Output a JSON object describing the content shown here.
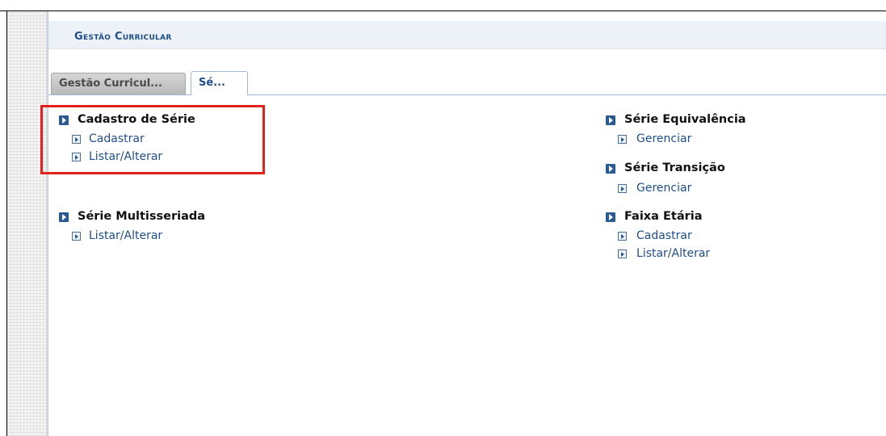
{
  "header": {
    "title": "Gestão Curricular"
  },
  "tabs": [
    {
      "label": "Gestão Curricul...",
      "active": false
    },
    {
      "label": "Sé...",
      "active": true
    }
  ],
  "sections": {
    "cadastro_de_serie": {
      "title": "Cadastro de Série",
      "links": [
        "Cadastrar",
        "Listar/Alterar"
      ]
    },
    "serie_multisseriada": {
      "title": "Série Multisseriada",
      "links": [
        "Listar/Alterar"
      ]
    },
    "serie_equivalencia": {
      "title": "Série Equivalência",
      "links": [
        "Gerenciar"
      ]
    },
    "serie_transicao": {
      "title": "Série Transição",
      "links": [
        "Gerenciar"
      ]
    },
    "faixa_etaria": {
      "title": "Faixa Etária",
      "links": [
        "Cadastrar",
        "Listar/Alterar"
      ]
    }
  },
  "colors": {
    "link": "#1f4e8a",
    "title": "#1f4e8a",
    "highlight": "#e3201c",
    "header_bg": "#edf2f8"
  },
  "icons": {
    "section_bullet": "play-square-icon",
    "link_bullet": "play-outline-square-icon"
  }
}
